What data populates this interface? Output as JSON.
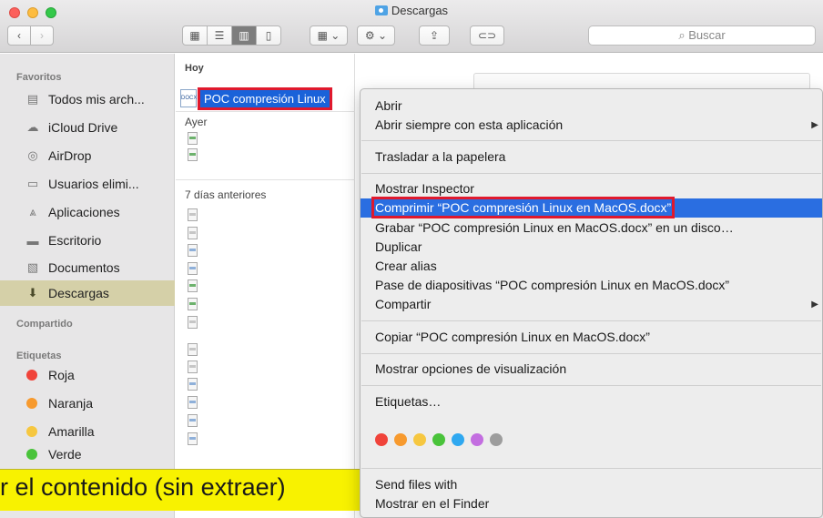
{
  "window": {
    "title": "Descargas"
  },
  "toolbar": {
    "back_icon": "chevron-left-icon",
    "forward_icon": "chevron-right-icon",
    "search_placeholder": "Buscar"
  },
  "sidebar": {
    "favorites_header": "Favoritos",
    "favorites": [
      {
        "label": "Todos mis arch...",
        "icon": "all-files-icon"
      },
      {
        "label": "iCloud Drive",
        "icon": "cloud-icon"
      },
      {
        "label": "AirDrop",
        "icon": "airdrop-icon"
      },
      {
        "label": "Usuarios elimi...",
        "icon": "folder-icon"
      },
      {
        "label": "Aplicaciones",
        "icon": "applications-icon"
      },
      {
        "label": "Escritorio",
        "icon": "desktop-icon"
      },
      {
        "label": "Documentos",
        "icon": "documents-icon"
      },
      {
        "label": "Descargas",
        "icon": "downloads-icon"
      }
    ],
    "shared_header": "Compartido",
    "tags_header": "Etiquetas",
    "tags": [
      {
        "label": "Roja",
        "color": "#f0433a"
      },
      {
        "label": "Naranja",
        "color": "#f79a2e"
      },
      {
        "label": "Amarilla",
        "color": "#f6c740"
      },
      {
        "label": "Verde",
        "color": "#49c33a"
      }
    ]
  },
  "files": {
    "today_header": "Hoy",
    "selected_file": "POC compresión Linux",
    "selected_file_icon_text": "DOCX",
    "yesterday_header": "Ayer",
    "week_header": "7 días anteriores"
  },
  "caption": "r el contenido (sin extraer)",
  "menu": {
    "items": {
      "abrir": "Abrir",
      "abrir_con": "Abrir siempre con esta aplicación",
      "papelera": "Trasladar a la papelera",
      "inspector": "Mostrar Inspector",
      "comprimir": "Comprimir “POC compresión Linux en MacOS.docx”",
      "grabar": "Grabar “POC compresión Linux en MacOS.docx” en un disco…",
      "duplicar": "Duplicar",
      "alias": "Crear alias",
      "diapositivas": "Pase de diapositivas “POC compresión Linux en MacOS.docx”",
      "compartir": "Compartir",
      "copiar": "Copiar “POC compresión Linux en MacOS.docx”",
      "visualizacion": "Mostrar opciones de visualización",
      "etiquetas": "Etiquetas…",
      "send_files": "Send files with",
      "finder": "Mostrar en el Finder"
    },
    "tag_colors": [
      "#f0433a",
      "#f79a2e",
      "#f6c740",
      "#49c33a",
      "#2fa8f0",
      "#c36ee0",
      "#9d9d9d"
    ]
  }
}
